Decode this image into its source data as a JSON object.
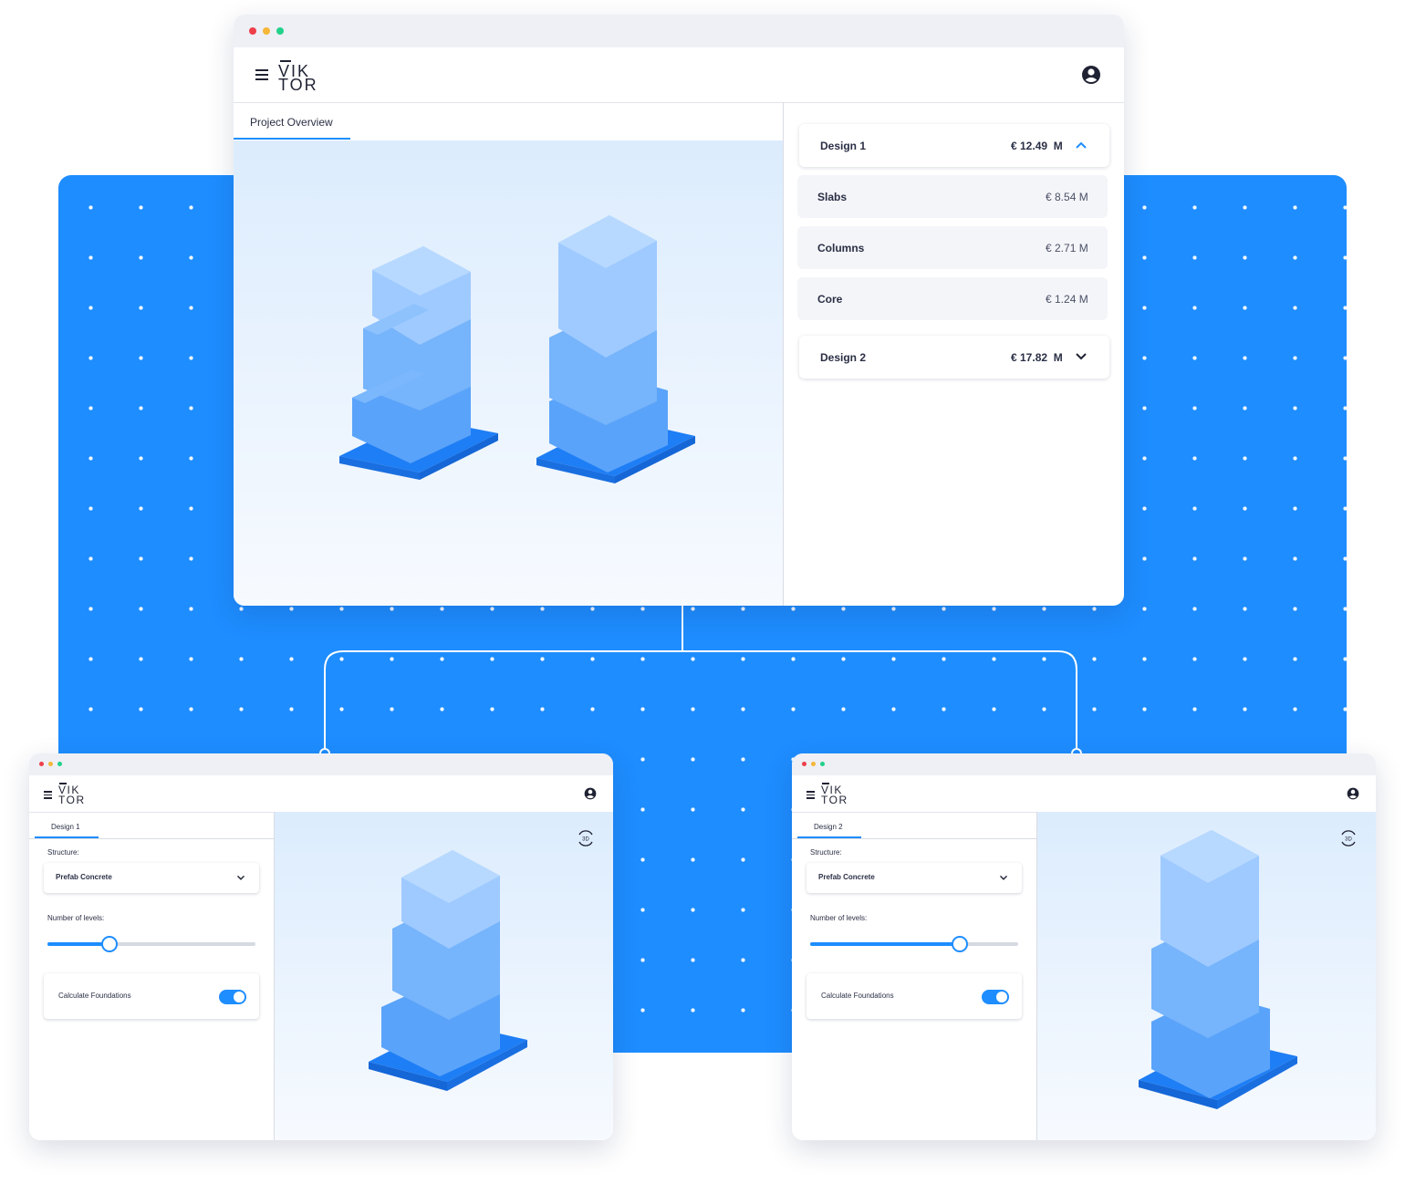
{
  "colors": {
    "accent": "#1e8dff",
    "background_panel": "#1e8dff",
    "dot_red": "#ef3f4b",
    "dot_yellow": "#f6b637",
    "dot_green": "#22d18b"
  },
  "main_window": {
    "logo": {
      "line1": "VIK",
      "line2": "TOR"
    },
    "tab_label": "Project Overview",
    "designs": [
      {
        "name": "Design 1",
        "cost": "€ 12.49  M",
        "expanded": true,
        "items": [
          {
            "label": "Slabs",
            "value": "€ 8.54 M"
          },
          {
            "label": "Columns",
            "value": "€ 2.71 M"
          },
          {
            "label": "Core",
            "value": "€ 1.24 M"
          }
        ]
      },
      {
        "name": "Design 2",
        "cost": "€ 17.82  M",
        "expanded": false
      }
    ]
  },
  "design1_window": {
    "logo": {
      "line1": "VIK",
      "line2": "TOR"
    },
    "tab_label": "Design 1",
    "structure_label": "Structure:",
    "structure_value": "Prefab Concrete",
    "levels_label": "Number of levels:",
    "levels_fraction": 0.3,
    "toggle_label": "Calculate Foundations",
    "toggle_on": true,
    "view_badge": "3D"
  },
  "design2_window": {
    "logo": {
      "line1": "VIK",
      "line2": "TOR"
    },
    "tab_label": "Design 2",
    "structure_label": "Structure:",
    "structure_value": "Prefab Concrete",
    "levels_label": "Number of levels:",
    "levels_fraction": 0.72,
    "toggle_label": "Calculate Foundations",
    "toggle_on": true,
    "view_badge": "3D"
  }
}
